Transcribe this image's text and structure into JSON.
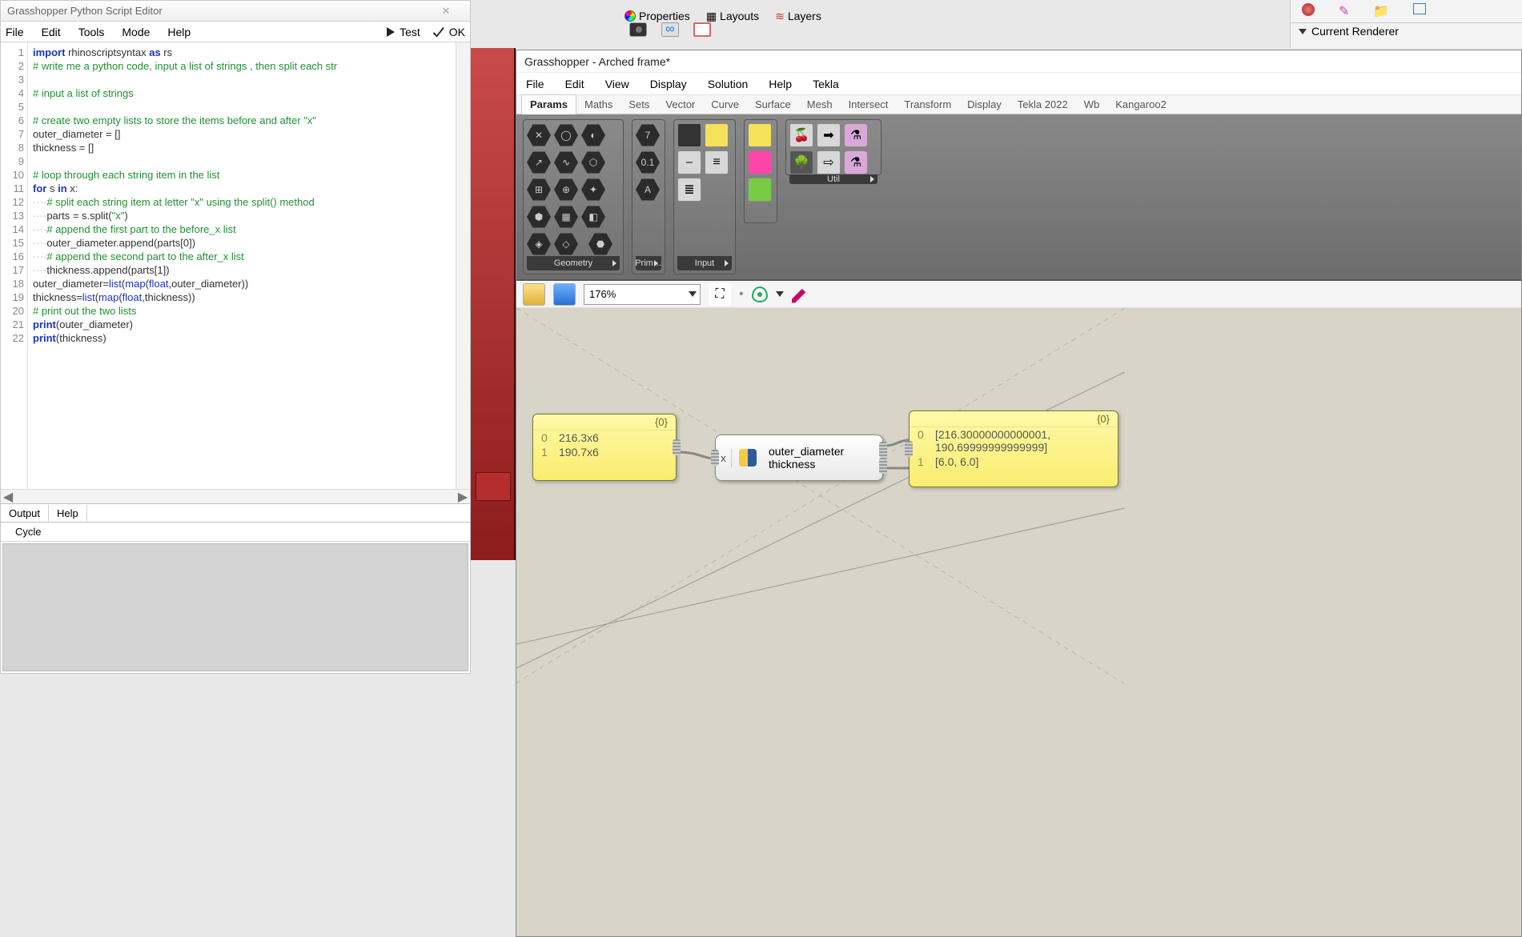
{
  "scriptEditor": {
    "title": "Grasshopper Python Script Editor",
    "menu": [
      "File",
      "Edit",
      "Tools",
      "Mode",
      "Help"
    ],
    "testLabel": "Test",
    "okLabel": "OK",
    "code": {
      "lines": [
        {
          "n": "1",
          "html": "<span class='kw'>import</span> rhinoscriptsyntax <span class='kw'>as</span> rs"
        },
        {
          "n": "2",
          "html": "<span class='cm'># write me a python code, input a list of strings , then split each str</span>"
        },
        {
          "n": "3",
          "html": ""
        },
        {
          "n": "4",
          "html": "<span class='cm'># input a list of strings</span>"
        },
        {
          "n": "5",
          "html": ""
        },
        {
          "n": "6",
          "html": "<span class='cm'># create two empty lists to store the items before and after \"x\"</span>"
        },
        {
          "n": "7",
          "html": "outer_diameter = []"
        },
        {
          "n": "8",
          "html": "thickness = []"
        },
        {
          "n": "9",
          "html": ""
        },
        {
          "n": "10",
          "html": "<span class='cm'># loop through each string item in the list</span>"
        },
        {
          "n": "11",
          "html": "<span class='kw'>for</span> s <span class='kw'>in</span> x:"
        },
        {
          "n": "12",
          "html": "<span class='dots'>····</span><span class='cm'># split each string item at letter \"x\" using the split() method</span>"
        },
        {
          "n": "13",
          "html": "<span class='dots'>····</span>parts = s.split(<span class='str'>\"x\"</span>)"
        },
        {
          "n": "14",
          "html": "<span class='dots'>····</span><span class='cm'># append the first part to the before_x list</span>"
        },
        {
          "n": "15",
          "html": "<span class='dots'>····</span>outer_diameter.append(parts[0])"
        },
        {
          "n": "16",
          "html": "<span class='dots'>····</span><span class='cm'># append the second part to the after_x list</span>"
        },
        {
          "n": "17",
          "html": "<span class='dots'>····</span>thickness.append(parts[1])"
        },
        {
          "n": "18",
          "html": "outer_diameter=<span class='fn'>list</span>(<span class='fn'>map</span>(<span class='fn'>float</span>,outer_diameter))"
        },
        {
          "n": "19",
          "html": "thickness=<span class='fn'>list</span>(<span class='fn'>map</span>(<span class='fn'>float</span>,thickness))"
        },
        {
          "n": "20",
          "html": "<span class='cm'># print out the two lists</span>"
        },
        {
          "n": "21",
          "html": "<span class='kw'>print</span>(outer_diameter)"
        },
        {
          "n": "22",
          "html": "<span class='kw'>print</span>(thickness)"
        }
      ]
    },
    "outputTabs": [
      "Output",
      "Help"
    ],
    "outputRow": "Cycle"
  },
  "rhinoPanels": {
    "properties": "Properties",
    "layouts": "Layouts",
    "layers": "Layers",
    "currentRenderer": "Current Renderer"
  },
  "gh": {
    "title": "Grasshopper - Arched frame*",
    "menu": [
      "File",
      "Edit",
      "View",
      "Display",
      "Solution",
      "Help",
      "Tekla"
    ],
    "tabs": [
      "Params",
      "Maths",
      "Sets",
      "Vector",
      "Curve",
      "Surface",
      "Mesh",
      "Intersect",
      "Transform",
      "Display",
      "Tekla 2022",
      "Wb",
      "Kangaroo2"
    ],
    "activeTab": "Params",
    "ribbonGroups": {
      "geometry": "Geometry",
      "prim": "Prim…",
      "input": "Input",
      "util": "Util"
    },
    "zoom": "176%"
  },
  "canvas": {
    "inputPanel": {
      "header": "{0}",
      "rows": [
        {
          "idx": "0",
          "val": "216.3x6"
        },
        {
          "idx": "1",
          "val": "190.7x6"
        }
      ]
    },
    "pythonNode": {
      "input": "x",
      "out1": "outer_diameter",
      "out2": "thickness"
    },
    "outputPanel": {
      "header": "{0}",
      "rows": [
        {
          "idx": "0",
          "val": "[216.30000000000001,\n190.69999999999999]"
        },
        {
          "idx": "1",
          "val": "[6.0, 6.0]"
        }
      ]
    }
  }
}
